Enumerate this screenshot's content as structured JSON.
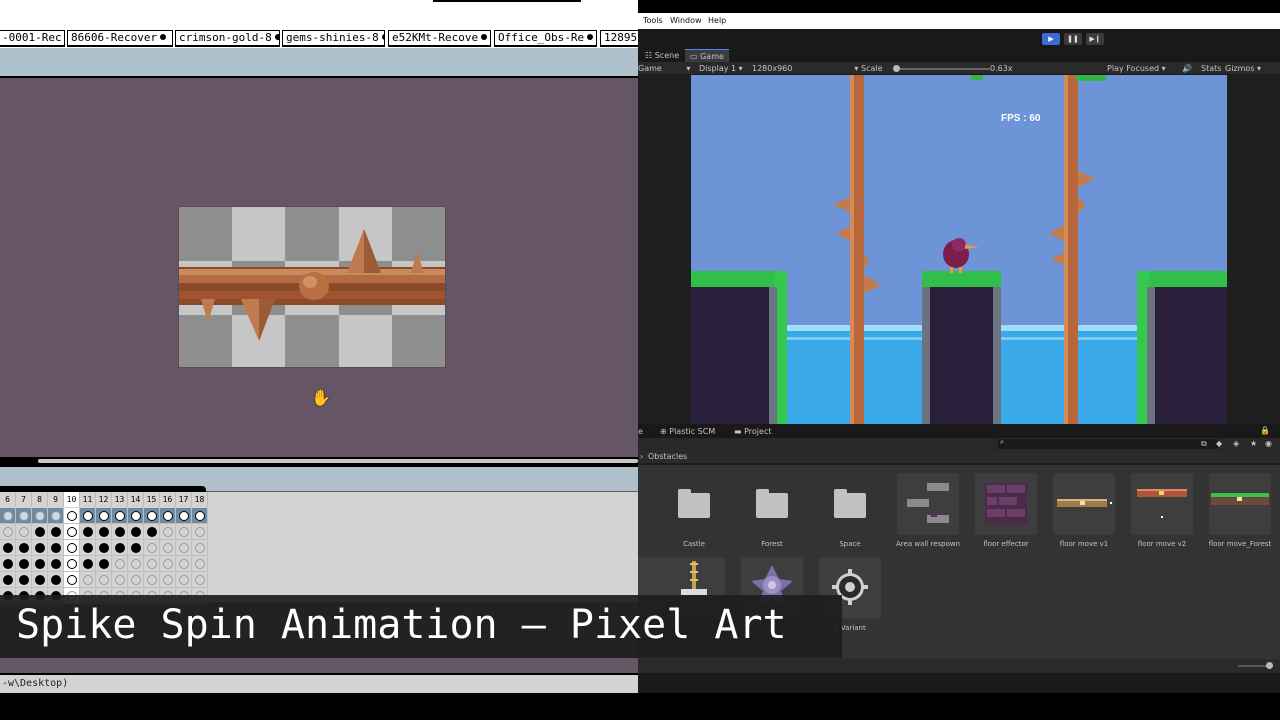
{
  "aseprite": {
    "tabs": [
      {
        "label": "-0001-Rec"
      },
      {
        "label": "86606-Recover"
      },
      {
        "label": "crimson-gold-8"
      },
      {
        "label": "gems-shinies-8"
      },
      {
        "label": "e52KMt-Recove"
      },
      {
        "label": "Office_Obs-Re"
      },
      {
        "label": "12895"
      }
    ],
    "frame_numbers": [
      "6",
      "7",
      "8",
      "9",
      "10",
      "11",
      "12",
      "13",
      "14",
      "15",
      "16",
      "17",
      "18"
    ],
    "current_frame": "10",
    "status_path": "-w\\Desktop)"
  },
  "caption": {
    "text": "Spike Spin Animation – Pixel Art"
  },
  "unity": {
    "menu": [
      "Tools",
      "Window",
      "Help"
    ],
    "view_tabs": {
      "scene": "Scene",
      "game": "Game"
    },
    "game_toolbar": {
      "mode": "Game",
      "display": "Display 1",
      "resolution": "1280x960",
      "scale_label": "Scale",
      "scale_value": "0.63x",
      "play_focused": "Play Focused",
      "stats": "Stats",
      "gizmos": "Gizmos"
    },
    "fps_text": "FPS : 60",
    "panel_tabs": {
      "plastic": "Plastic SCM",
      "project": "Project"
    },
    "breadcrumb": "Obstacles",
    "assets": [
      {
        "label": "Castle",
        "icon": "folder-icon"
      },
      {
        "label": "Forest",
        "icon": "folder-icon"
      },
      {
        "label": "Space",
        "icon": "folder-icon"
      },
      {
        "label": "Area wall respown",
        "icon": "prefab-icon"
      },
      {
        "label": "floor effector",
        "icon": "prefab-icon"
      },
      {
        "label": "floor move v1",
        "icon": "prefab-icon"
      },
      {
        "label": "floor move v2",
        "icon": "prefab-icon"
      },
      {
        "label": "floor move_Forest",
        "icon": "prefab-icon"
      },
      {
        "label": "",
        "icon": "prefab-icon"
      },
      {
        "label": "",
        "icon": "prefab-icon"
      },
      {
        "label": "",
        "icon": "prefab-icon"
      },
      {
        "label": "4 Variant",
        "icon": "prefab-icon"
      }
    ]
  }
}
